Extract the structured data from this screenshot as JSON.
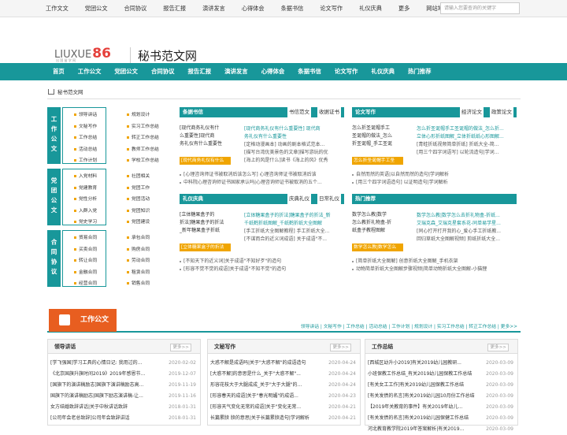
{
  "top_links": [
    "工作文文",
    "党团公文",
    "合同协议",
    "报告汇报",
    "演讲发言",
    "心得体会",
    "条据书信",
    "论文写作",
    "礼仪庆典",
    "更多",
    "网站地图"
  ],
  "search_placeholder": "请输入您要查询的关键字",
  "logo": {
    "text": "LIUXUE",
    "num": "86",
    "sub": "出 国 留 学 网"
  },
  "site_name": "秘书范文网",
  "nav": [
    "首页",
    "工作公文",
    "党团公文",
    "合同协议",
    "报告汇报",
    "演讲发言",
    "心得体会",
    "条据书信",
    "论文写作",
    "礼仪庆典",
    "热门推荐"
  ],
  "breadcrumb": "秘书范文网",
  "cat_tags": [
    "工作公文",
    "党团公文",
    "合同协议"
  ],
  "cat1": [
    [
      "领导讲话",
      "规划设计"
    ],
    [
      "文秘写作",
      "实习工作总结"
    ],
    [
      "工作总结",
      "转正工作总结"
    ],
    [
      "活动总结",
      "教师工作总结"
    ],
    [
      "工作计划",
      "学校工作总结"
    ]
  ],
  "cat2": [
    [
      "入党材料",
      "社团相关"
    ],
    [
      "党建教育",
      "党团工作"
    ],
    [
      "党性分析",
      "党团活动"
    ],
    [
      "入群入党",
      "党团知识"
    ],
    [
      "党史学习",
      "党团建设"
    ]
  ],
  "cat3": [
    [
      "贸易合同",
      "承包合同"
    ],
    [
      "买卖合同",
      "购房合同"
    ],
    [
      "转让合同",
      "劳动合同"
    ],
    [
      "金融合同",
      "租赁合同"
    ],
    [
      "经营合同",
      "销售合同"
    ]
  ],
  "p1": {
    "title": "条据书信",
    "more": [
      "书信范文",
      "收据证书"
    ],
    "thumb_txt": [
      "[现代商务礼仪有什",
      "么重要性]现代商",
      "务礼仪有什么重要性"
    ],
    "thumb_cap": "[现代商务礼仪有什么",
    "lead": [
      "[现代商务礼仪有什么重要性] 现代商",
      "务礼仪有什么重要性",
      "[定格动漫画本] 动画的剧本格式范本...",
      "[描写台湾优美景色的文章]描写游玩的优",
      "[海上的风是什么]读书《海上的风》优秀"
    ],
    "list": [
      "[心理咨询师证书被取消后该怎么写] 心理咨询师证书被取消后该",
      "中科院心理咨询师证书国家承认吗|心理咨询师证书被取消的五个..."
    ]
  },
  "p2": {
    "title": "论文写作",
    "more": [
      "经济论文",
      "政策论文"
    ],
    "thumb_txt": [
      "怎么折圣诞帽手工",
      "圣诞帽的做法_怎么",
      "折圣诞帽_手工圣诞"
    ],
    "thumb_cap": "怎么折圣诞帽手工圣",
    "lead": [
      "怎么折圣诞帽手工圣诞帽的做法_怎么折...",
      "立体心形折纸图解_立体折纸纸心形图解...",
      "[青蛙折纸视频简单折纸] 折纸大全-简...",
      "[用三个四字词语写] 以轮流造句|学词..."
    ],
    "list": [
      "自然而然的英语|以自然而然的造句|学词解析",
      "[用三个四字词语造句] 以证明造句|学词解析"
    ]
  },
  "p3": {
    "title": "礼仪庆典",
    "more": [
      "庆典礼仪",
      "日常礼仪"
    ],
    "thumb_txt": [
      "[立体糖果盒子的",
      "折法]糖果盒子的折法",
      "_新年糖果盒子折纸"
    ],
    "thumb_cap": "[立体糖果盒子的折法",
    "lead": [
      "[立体糖果盒子的折法]糖果盒子的折法_新",
      "千纸鹤折纸图解_千纸鹤折纸大全图解",
      "[手工折纸大全图解教程] 手工折纸大全...",
      "[不谋而合的近义词成语] 关于成语\"不..."
    ],
    "list": [
      "[不知天下的近义词]关于成语\"不知好歹\"的造句",
      "[形容不觉不觉的成语]关于成语\"不知不觉\"的造句"
    ]
  },
  "p4": {
    "title": "热门推荐",
    "more": [],
    "thumb_txt": [
      "数学怎么教|数学",
      "怎么教折礼物盒-折",
      "纸盒子教程图解"
    ],
    "thumb_cap": "数学怎么教|数学怎么",
    "lead": [
      "数学怎么教|数学怎么去折礼物盒-折纸...",
      "艾瑞克森_艾瑞克星套系花-同单易学星...",
      "[同心打开打开我的心_爱心手工折纸教...",
      "回归草纸大全图解视频] 剪纸折纸大全..."
    ],
    "list": [
      "[简单折纸大全图解] 创意折纸大全图解_手机衣架",
      "动物简单折纸大全图解步骤视频|简单动物折纸大全图解-小猫狸"
    ]
  },
  "section": {
    "title": "工作公文",
    "links": "领导讲话 | 文秘写作 | 工作总结 | 活动总结 | 工作计划 | 规划设计 | 实习工作总结 | 转正工作总结 | 更多>>"
  },
  "box_a": {
    "title": "领导讲话",
    "more": "更多>>",
    "items": [
      [
        "[学飞强国]学习工具的心情日记: 我用过的...",
        "2020-02-02"
      ],
      [
        "《北京国旗升旗时间2019》2019年感恩节...",
        "2019-12-07"
      ],
      [
        "[国旗下的演讲稿励志]国旗下演讲稿励志高...",
        "2019-11-19"
      ],
      [
        "国旗下的演讲稿励志|国旗下励志演讲稿-让...",
        "2019-11-16"
      ],
      [
        "女方结婚致辞讲话|关于中秋讲话致辞",
        "2018-01-31"
      ],
      [
        "[公司年会老总致辞]公司年会致辞讲话",
        "2018-01-31"
      ]
    ]
  },
  "box_b": {
    "title": "文秘写作",
    "more": "更多>>",
    "items": [
      [
        "大惑不解是成语吗|关于\"大惑不解\"的成语造句",
        "2020-04-24"
      ],
      [
        "[大惑不解]的意思是什么_关于\"大惑不解\"...",
        "2020-04-24"
      ],
      [
        "形容花枝大于大腿成成_关于\"大于大腿\"的...",
        "2020-04-24"
      ],
      [
        "[形容春天的成语]关于\"春光明媚\"的成语...",
        "2020-04-23"
      ],
      [
        "[形容天气变化无常的成语]关于\"变化无常...",
        "2020-04-21"
      ],
      [
        "长篇累牍 牍的意思|关于长篇累牍造句|学词解析",
        "2020-04-21"
      ]
    ]
  },
  "box_c": {
    "title": "工作总结",
    "more": "更多>>",
    "items": [
      [
        "[西城区幼升小2019]有关2019幼儿园教研...",
        "2020-03-09"
      ],
      [
        "小班保教工作总结_有关2019幼儿园保教工作总结",
        "2020-03-09"
      ],
      [
        "[有关女工工作]有关2019幼儿园保教工作总结",
        "2020-03-09"
      ],
      [
        "[有关发债的名言]有关2019幼儿园10月份工作总结",
        "2020-03-09"
      ],
      [
        "【2019年关教育的事件】有关2019年幼儿...",
        "2020-03-09"
      ],
      [
        "[有关发债的名言]有关2019幼儿园保健工作总结",
        "2020-03-09"
      ],
      [
        "河北教育教学院2019年答案解析|有关2019...",
        "2020-03-09"
      ]
    ]
  }
}
